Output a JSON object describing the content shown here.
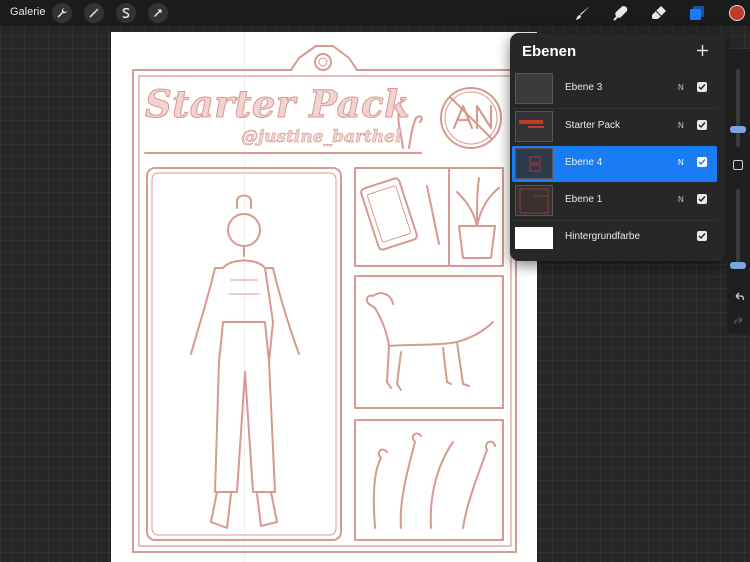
{
  "toolbar": {
    "gallery_label": "Galerie",
    "left_tools": [
      "wrench-icon",
      "magic-wand-icon",
      "selection-s-icon",
      "transform-arrow-icon"
    ],
    "right_tools": [
      "brush-icon",
      "smudge-icon",
      "eraser-icon",
      "layers-icon"
    ],
    "active_color": "#c0392b"
  },
  "canvas": {
    "title": "Starter Pack",
    "handle": "@justine_barthel",
    "logo_text": "AN",
    "art_color": "#d69a91"
  },
  "layers_panel": {
    "title": "Ebenen",
    "add_icon": "plus-icon",
    "layers": [
      {
        "name": "Ebene 3",
        "mode": "N",
        "visible": true,
        "selected": false
      },
      {
        "name": "Starter Pack",
        "mode": "N",
        "visible": true,
        "selected": false
      },
      {
        "name": "Ebene 4",
        "mode": "N",
        "visible": true,
        "selected": true
      },
      {
        "name": "Ebene 1",
        "mode": "N",
        "visible": true,
        "selected": false
      },
      {
        "name": "Hintergrundfarbe",
        "mode": "",
        "visible": true,
        "selected": false
      }
    ]
  },
  "sidebar": {
    "icons": [
      "brush-size-slider",
      "modify-square-icon",
      "opacity-slider",
      "undo-icon",
      "redo-icon"
    ]
  }
}
